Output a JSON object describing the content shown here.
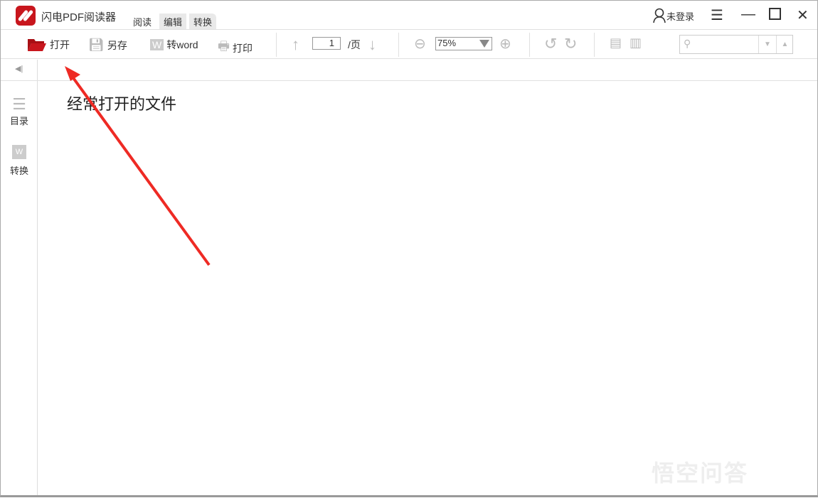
{
  "app": {
    "title": "闪电PDF阅读器",
    "tabs": [
      "阅读",
      "编辑",
      "转换"
    ],
    "user": "未登录"
  },
  "toolbar": {
    "open": "打开",
    "save_as": "另存",
    "to_word": "转word",
    "print": "打印",
    "page_value": "1",
    "page_suffix": "/页",
    "zoom": "75%"
  },
  "sidebar": {
    "items": [
      {
        "label": "目录",
        "icon": "list-icon"
      },
      {
        "label": "转换",
        "icon": "word-convert-icon"
      }
    ]
  },
  "main": {
    "heading": "经常打开的文件"
  },
  "watermark": "悟空问答",
  "colors": {
    "brand": "#c8161d",
    "annotation_arrow": "#ee2a24"
  }
}
